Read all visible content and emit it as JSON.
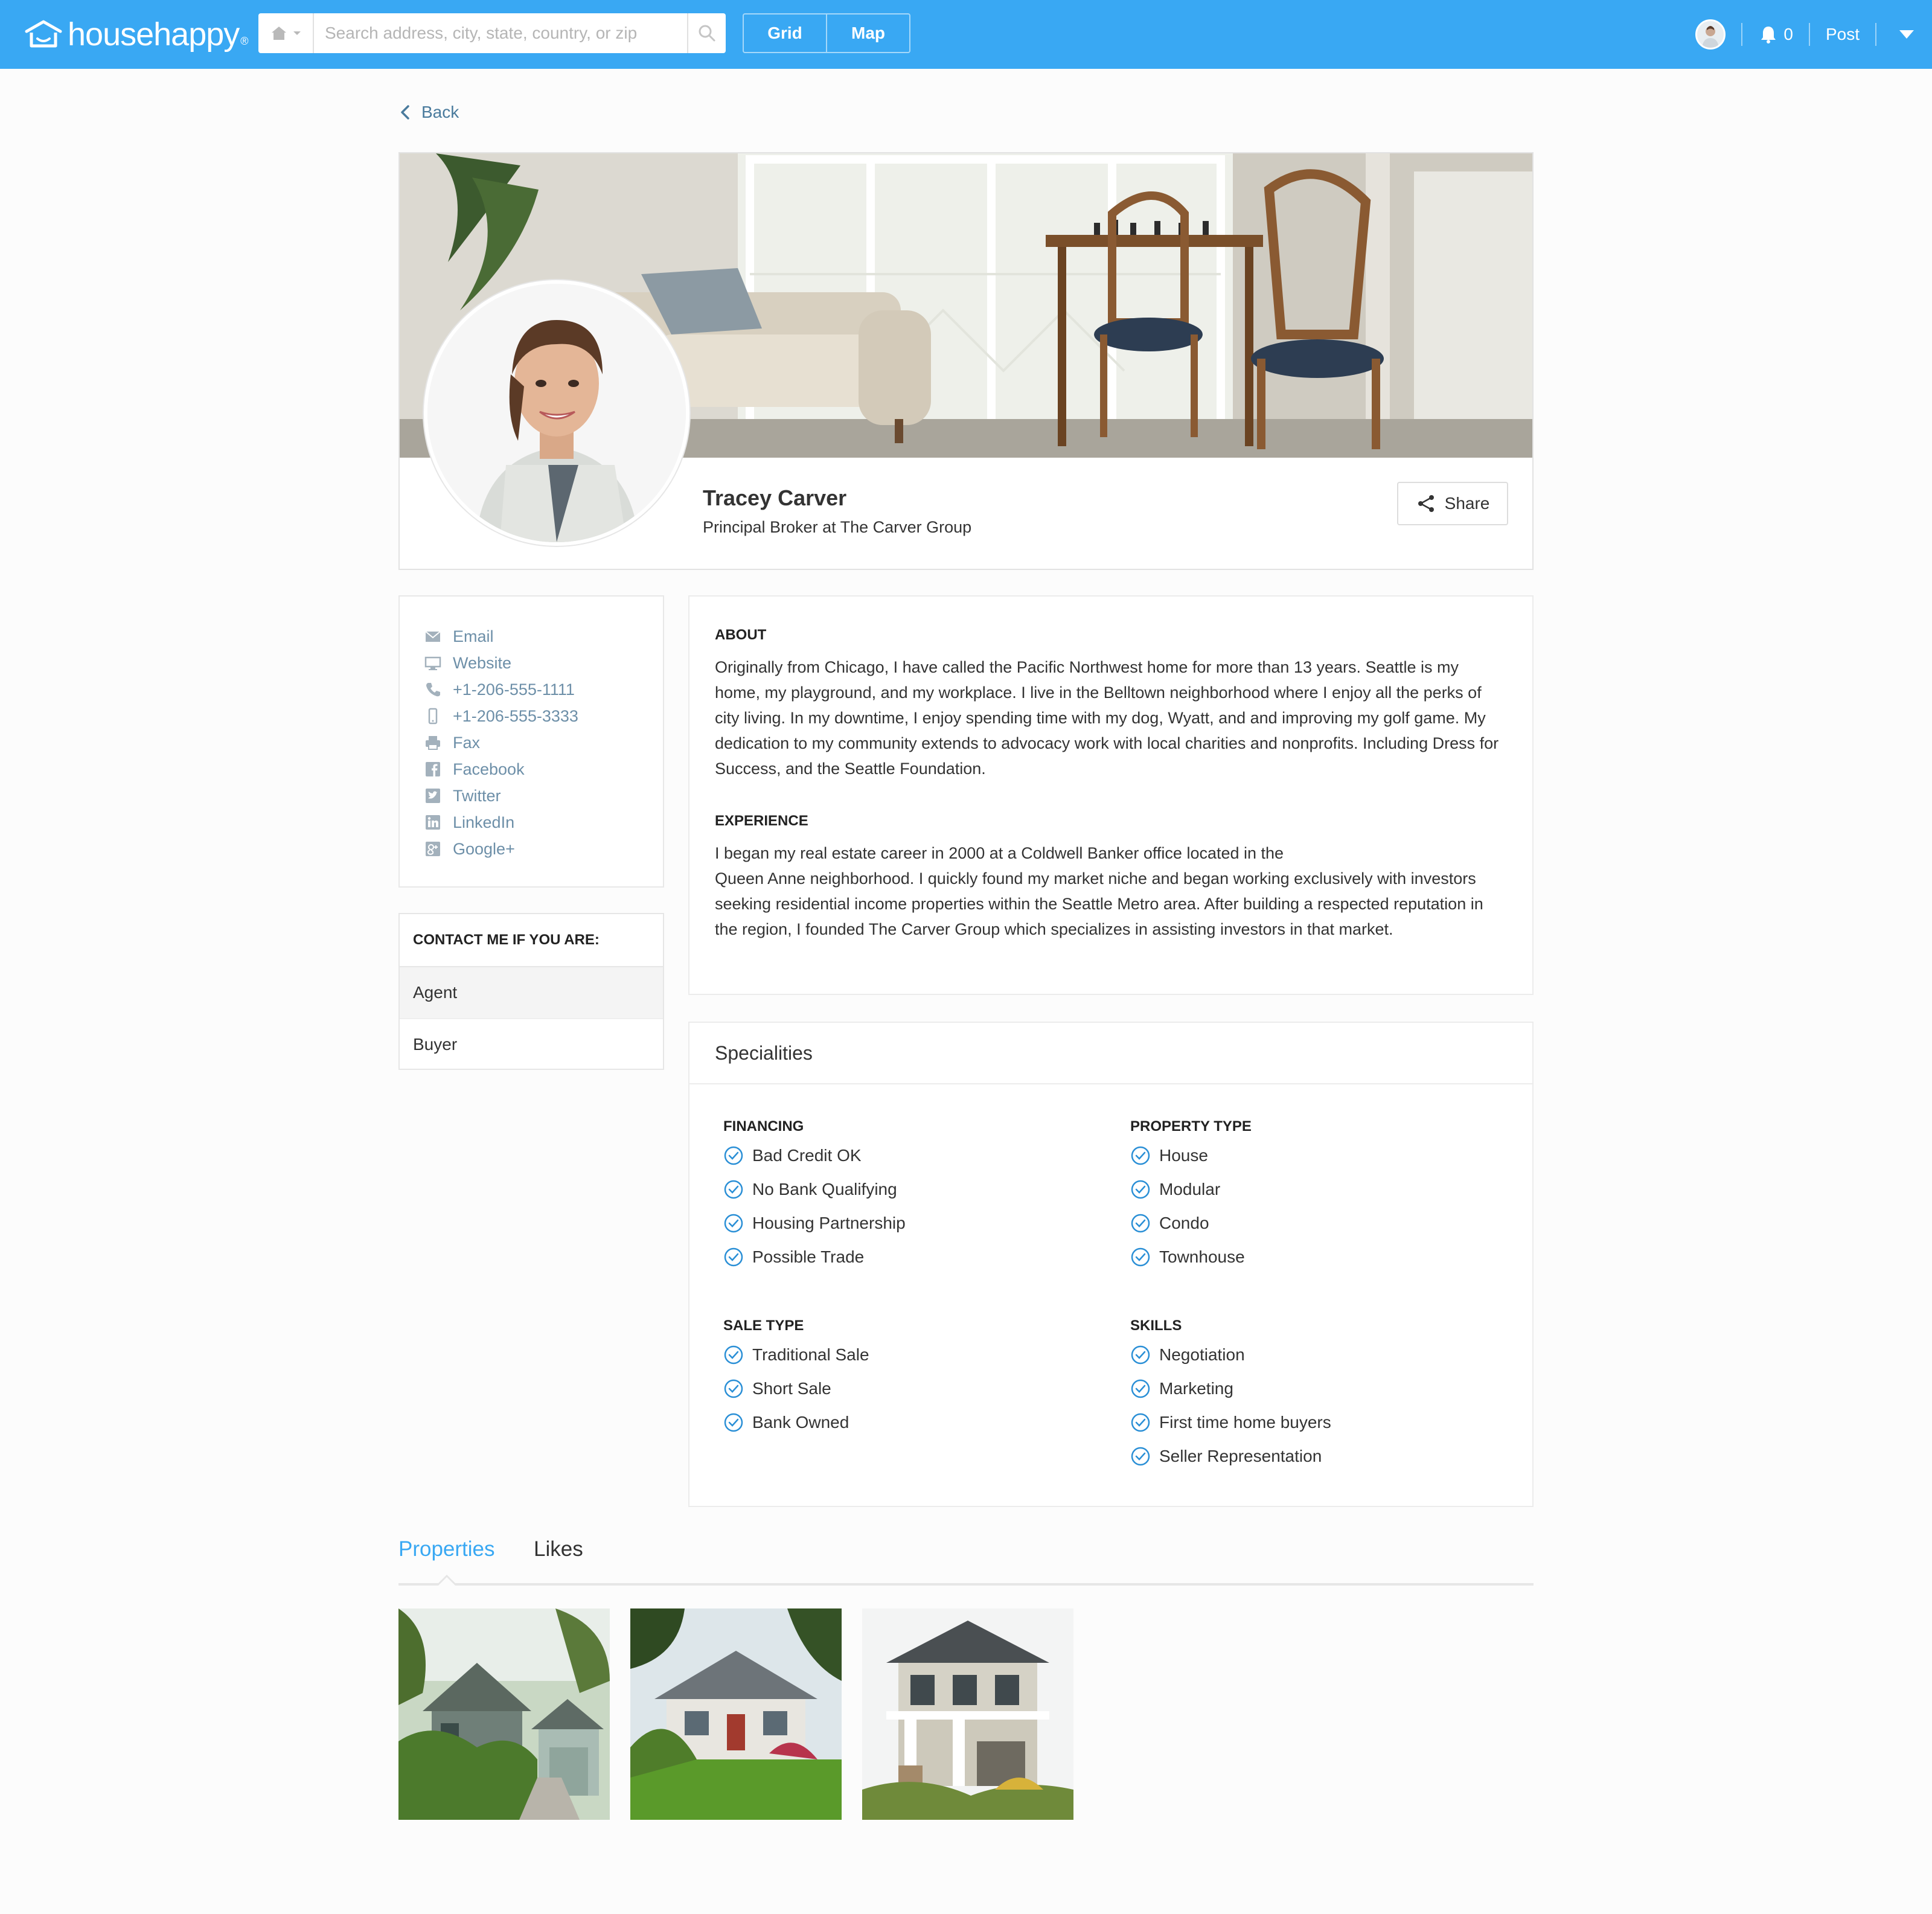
{
  "app": {
    "logo_text": "househappy",
    "logo_mark": "®"
  },
  "topbar": {
    "search_placeholder": "Search address, city, state, country, or zip",
    "view_grid": "Grid",
    "view_map": "Map",
    "notifications_count": "0",
    "post_label": "Post"
  },
  "nav": {
    "back_label": "Back"
  },
  "profile": {
    "name": "Tracey Carver",
    "title": "Principal Broker at The Carver Group",
    "share_label": "Share"
  },
  "contact_links": [
    {
      "label": "Email",
      "icon": "envelope-icon"
    },
    {
      "label": "Website",
      "icon": "monitor-icon"
    },
    {
      "label": "+1-206-555-1111",
      "icon": "phone-icon"
    },
    {
      "label": "+1-206-555-3333",
      "icon": "mobile-icon"
    },
    {
      "label": "Fax",
      "icon": "fax-icon"
    },
    {
      "label": "Facebook",
      "icon": "facebook-icon"
    },
    {
      "label": "Twitter",
      "icon": "twitter-icon"
    },
    {
      "label": "LinkedIn",
      "icon": "linkedin-icon"
    },
    {
      "label": "Google+",
      "icon": "googleplus-icon"
    }
  ],
  "contact_me": {
    "heading": "CONTACT ME IF YOU ARE:",
    "options": [
      "Agent",
      "Buyer"
    ],
    "selected": "Agent"
  },
  "about": {
    "heading": "ABOUT",
    "text": "Originally from Chicago, I have called the Pacific Northwest home for more than 13 years. Seattle is my home, my playground, and my workplace. I live in the Belltown neighborhood where I enjoy all the perks of city living. In my downtime, I enjoy spending time with my dog, Wyatt, and and improving my golf game. My dedication to my community extends to advocacy work with local charities and nonprofits. Including Dress for Success, and the Seattle Foundation."
  },
  "experience": {
    "heading": "EXPERIENCE",
    "line1": "I began my real estate career in 2000 at a Coldwell Banker office located in the",
    "line2": "Queen Anne neighborhood. I quickly found my market niche and began working exclusively with investors seeking residential income properties within the Seattle Metro area. After building a respected reputation in the region, I founded The Carver Group which specializes in assisting investors in that market."
  },
  "specialities": {
    "heading": "Specialities",
    "groups": [
      {
        "heading": "FINANCING",
        "items": [
          "Bad Credit OK",
          "No Bank Qualifying",
          "Housing Partnership",
          "Possible Trade"
        ]
      },
      {
        "heading": "PROPERTY TYPE",
        "items": [
          "House",
          "Modular",
          "Condo",
          "Townhouse"
        ]
      },
      {
        "heading": "SALE TYPE",
        "items": [
          "Traditional Sale",
          "Short Sale",
          "Bank Owned"
        ]
      },
      {
        "heading": "SKILLS",
        "items": [
          "Negotiation",
          "Marketing",
          "First time home buyers",
          "Seller Representation"
        ]
      }
    ]
  },
  "tabs": {
    "items": [
      "Properties",
      "Likes"
    ],
    "active": "Properties"
  },
  "colors": {
    "brand_blue": "#39a8f3",
    "link_gray_blue": "#6d8fa8",
    "check_blue": "#2a8fd6"
  }
}
